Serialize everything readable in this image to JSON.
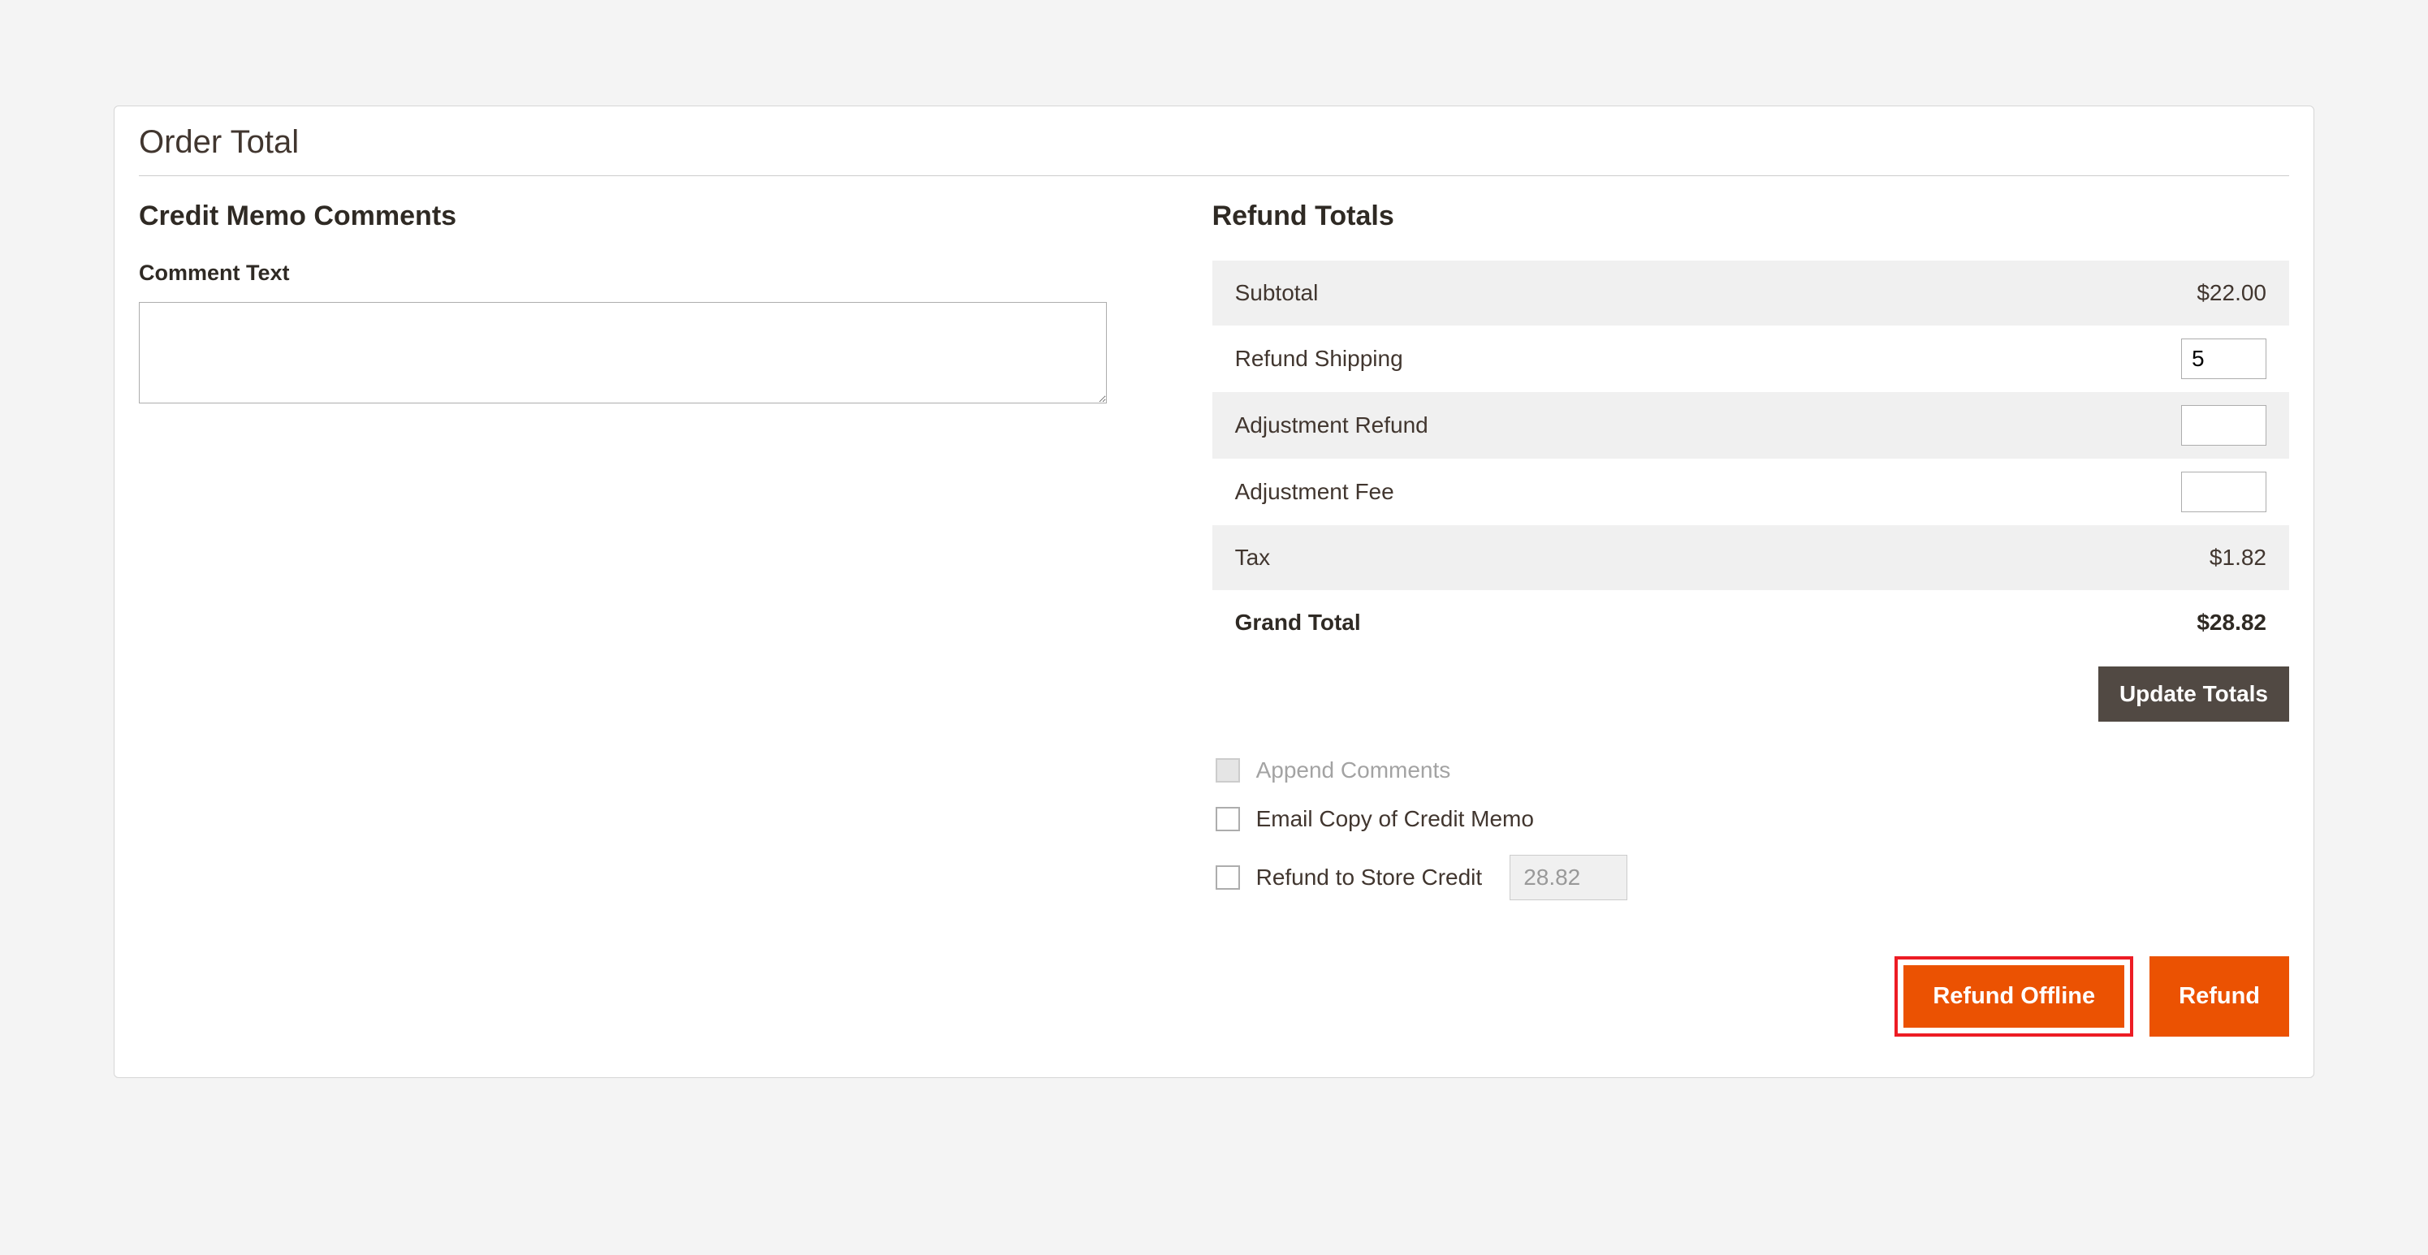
{
  "panel": {
    "title": "Order Total"
  },
  "comments": {
    "section_title": "Credit Memo Comments",
    "label": "Comment Text",
    "value": ""
  },
  "refund_totals": {
    "section_title": "Refund Totals",
    "rows": {
      "subtotal": {
        "label": "Subtotal",
        "value": "$22.00"
      },
      "refund_shipping": {
        "label": "Refund Shipping",
        "value": "5"
      },
      "adjustment_refund": {
        "label": "Adjustment Refund",
        "value": ""
      },
      "adjustment_fee": {
        "label": "Adjustment Fee",
        "value": ""
      },
      "tax": {
        "label": "Tax",
        "value": "$1.82"
      },
      "grand_total": {
        "label": "Grand Total",
        "value": "$28.82"
      }
    },
    "update_button": "Update Totals"
  },
  "options": {
    "append_comments": "Append Comments",
    "email_copy": "Email Copy of Credit Memo",
    "refund_store_credit": "Refund to Store Credit",
    "store_credit_value": "28.82"
  },
  "actions": {
    "refund_offline": "Refund Offline",
    "refund": "Refund"
  }
}
